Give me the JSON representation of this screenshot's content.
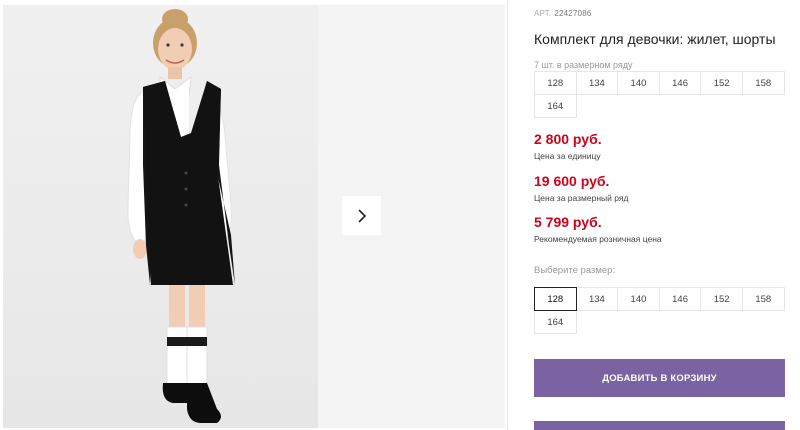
{
  "product": {
    "article_label": "АРТ.",
    "article_number": "22427086",
    "title": "Комплект для девочки: жилет, шорты",
    "count_note": "7 шт. в размерном ряду",
    "info_sizes": [
      "128",
      "134",
      "140",
      "146",
      "152",
      "158",
      "164"
    ]
  },
  "prices": {
    "unit_price": "2 800 руб.",
    "unit_price_label": "Цена за единицу",
    "range_price": "19 600 руб.",
    "range_price_label": "Цена за размерный ряд",
    "retail_price": "5 799 руб.",
    "retail_price_label": "Рекомендуемая розничная цена",
    "price_color": "#d0021b"
  },
  "size_select": {
    "label": "Выберите размер:",
    "sizes": [
      "128",
      "134",
      "140",
      "146",
      "152",
      "158",
      "164"
    ],
    "selected": "128"
  },
  "actions": {
    "add_to_cart": "ДОБАВИТЬ В КОРЗИНУ",
    "button_color": "#7b62a0"
  },
  "gallery": {
    "next_icon": "chevron-right-icon"
  }
}
